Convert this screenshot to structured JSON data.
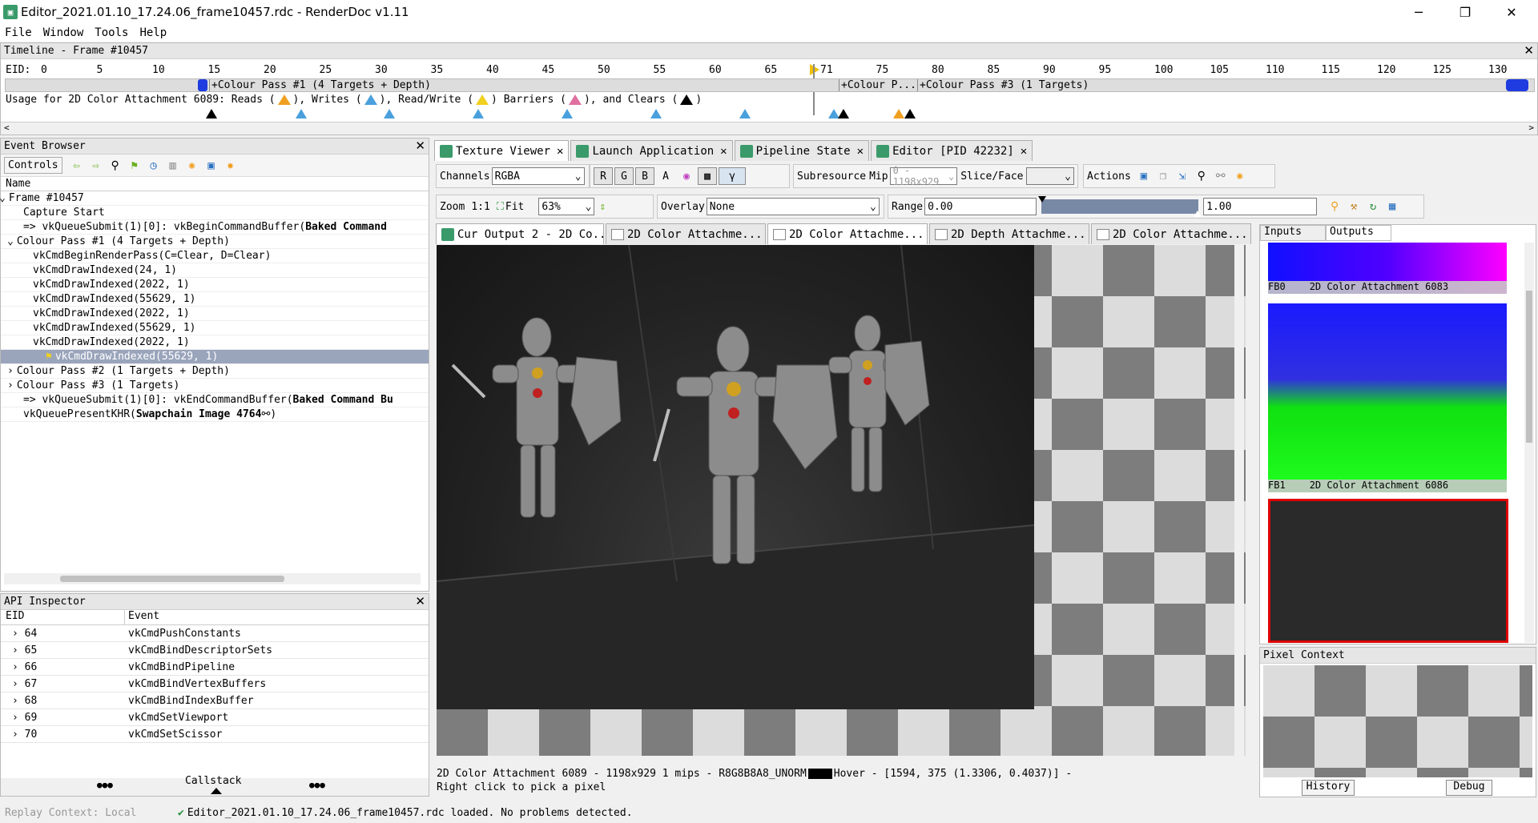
{
  "window": {
    "title": "Editor_2021.01.10_17.24.06_frame10457.rdc - RenderDoc v1.11",
    "min": "─",
    "max": "❐",
    "close": "✕"
  },
  "menu": [
    "File",
    "Window",
    "Tools",
    "Help"
  ],
  "timeline": {
    "title": "Timeline - Frame #10457",
    "eid_label": "EID:",
    "ticks": [
      "0",
      "5",
      "10",
      "15",
      "20",
      "25",
      "30",
      "35",
      "40",
      "45",
      "50",
      "55",
      "60",
      "65",
      "71",
      "75",
      "80",
      "85",
      "90",
      "95",
      "100",
      "105",
      "110",
      "115",
      "120",
      "125",
      "130"
    ],
    "passes": [
      "+Colour Pass #1 (4 Targets + Depth)",
      "+Colour P...",
      "+Colour Pass #3 (1 Targets)"
    ],
    "usage": {
      "prefix": "Usage for 2D Color Attachment 6089: Reads (",
      "w": "), Writes (",
      "rw": "), Read/Write (",
      "b": ") Barriers (",
      "c": "), and Clears (",
      "end": ")"
    }
  },
  "event_browser": {
    "title": "Event Browser",
    "controls_label": "Controls",
    "column": "Name",
    "items": [
      {
        "t": "Frame #10457",
        "bold": ""
      },
      {
        "t": "Capture Start",
        "bold": ""
      },
      {
        "t": "=> vkQueueSubmit(1)[0]: vkBeginCommandBuffer(",
        "bold": "Baked Command"
      },
      {
        "t": "Colour Pass #1 (4 Targets + Depth)",
        "bold": ""
      },
      {
        "t": "vkCmdBeginRenderPass(C=Clear, D=Clear)",
        "bold": ""
      },
      {
        "t": "vkCmdDrawIndexed(24, 1)",
        "bold": ""
      },
      {
        "t": "vkCmdDrawIndexed(2022, 1)",
        "bold": ""
      },
      {
        "t": "vkCmdDrawIndexed(55629, 1)",
        "bold": ""
      },
      {
        "t": "vkCmdDrawIndexed(2022, 1)",
        "bold": ""
      },
      {
        "t": "vkCmdDrawIndexed(55629, 1)",
        "bold": ""
      },
      {
        "t": "vkCmdDrawIndexed(2022, 1)",
        "bold": ""
      },
      {
        "t": "vkCmdDrawIndexed(55629, 1)",
        "bold": ""
      },
      {
        "t": "Colour Pass #2 (1 Targets + Depth)",
        "bold": ""
      },
      {
        "t": "Colour Pass #3 (1 Targets)",
        "bold": ""
      },
      {
        "t": "=> vkQueueSubmit(1)[0]: vkEndCommandBuffer(",
        "bold": "Baked Command Bu"
      },
      {
        "t": "vkQueuePresentKHR(",
        "bold": "Swapchain Image 4764"
      }
    ],
    "present_suffix": ")"
  },
  "api_inspector": {
    "title": "API Inspector",
    "columns": [
      "EID",
      "Event"
    ],
    "rows": [
      [
        "64",
        "vkCmdPushConstants"
      ],
      [
        "65",
        "vkCmdBindDescriptorSets"
      ],
      [
        "66",
        "vkCmdBindPipeline"
      ],
      [
        "67",
        "vkCmdBindVertexBuffers"
      ],
      [
        "68",
        "vkCmdBindIndexBuffer"
      ],
      [
        "69",
        "vkCmdSetViewport"
      ],
      [
        "70",
        "vkCmdSetScissor"
      ]
    ],
    "callstack": "Callstack",
    "dots": "●●●"
  },
  "main_tabs": [
    "Texture Viewer",
    "Launch Application",
    "Pipeline State",
    "Editor [PID 42232]"
  ],
  "toolbar": {
    "channels": "Channels",
    "channels_value": "RGBA",
    "r": "R",
    "g": "G",
    "b": "B",
    "a": "A",
    "gamma": "γ",
    "subresource": "Subresource",
    "mip": "Mip",
    "mip_value": "0 - 1198x929",
    "slice": "Slice/Face",
    "actions": "Actions",
    "zoom": "Zoom",
    "zoom_11": "1:1",
    "fit": "Fit",
    "zoom_value": "63%",
    "overlay": "Overlay",
    "overlay_value": "None",
    "range": "Range",
    "range_min": "0.00",
    "range_max": "1.00"
  },
  "tex_tabs": [
    "Cur Output 2 - 2D Co...",
    "2D Color Attachme...",
    "2D Color Attachme...",
    "2D Depth Attachme...",
    "2D Color Attachme..."
  ],
  "status_bar": {
    "line1": "2D Color Attachment 6089 - 1198x929 1 mips - R8G8B8A8_UNORM",
    "hover": "Hover - [1594,  375 (1.3306, 0.4037)] -",
    "line2": "Right click to pick a pixel"
  },
  "side": {
    "tabs": [
      "Inputs",
      "Outputs"
    ],
    "thumbs": [
      {
        "fb": "FB0",
        "name": "2D Color Attachment 6083"
      },
      {
        "fb": "FB1",
        "name": "2D Color Attachment 6086"
      }
    ],
    "pixel_context": "Pixel Context",
    "history": "History",
    "debug": "Debug"
  },
  "bottom": {
    "replay": "Replay Context: Local",
    "loaded": "Editor_2021.01.10_17.24.06_frame10457.rdc loaded. No problems detected."
  },
  "colors": {
    "read": "#3a9ad9",
    "write": "#4aa0dc",
    "readwrite": "#f0d020",
    "barrier": "#e070a0",
    "clear": "#000000",
    "orange": "#f0a020",
    "pass": "#1e3ce0"
  }
}
